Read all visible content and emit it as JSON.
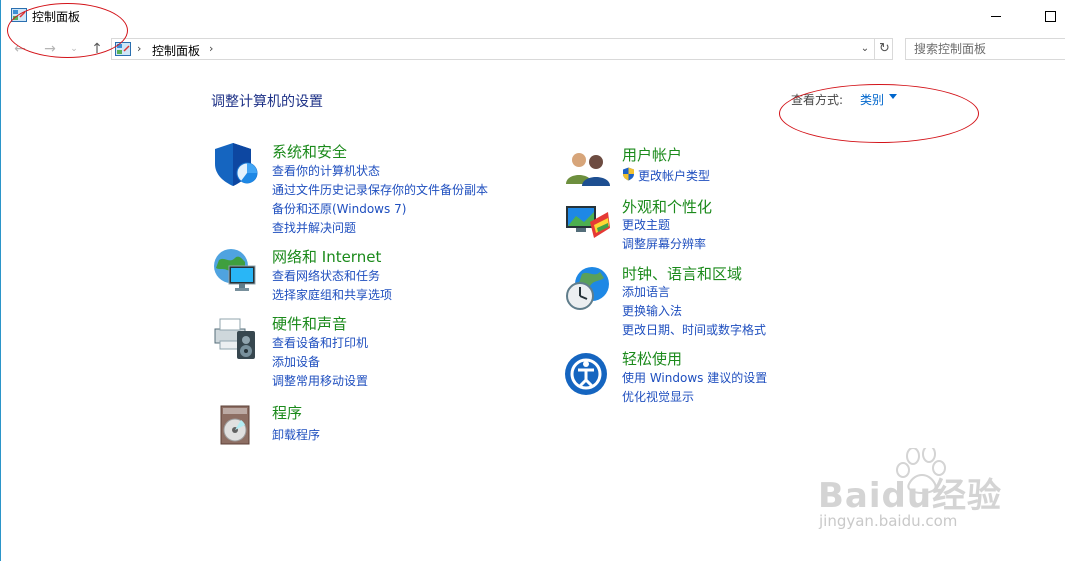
{
  "window": {
    "title": "控制面板"
  },
  "nav": {
    "back_glyph": "←",
    "forward_glyph": "→",
    "recent_glyph": "⌄",
    "up_glyph": "↑"
  },
  "address": {
    "separator": "›",
    "location": "控制面板",
    "dropdown_glyph": "⌄",
    "refresh_glyph": "↻"
  },
  "search": {
    "placeholder": "搜索控制面板"
  },
  "page": {
    "heading": "调整计算机的设置",
    "view_by_label": "查看方式:",
    "view_by_value": "类别"
  },
  "categories": {
    "system_security": {
      "title": "系统和安全",
      "links": [
        "查看你的计算机状态",
        "通过文件历史记录保存你的文件备份副本",
        "备份和还原(Windows 7)",
        "查找并解决问题"
      ]
    },
    "network": {
      "title": "网络和 Internet",
      "links": [
        "查看网络状态和任务",
        "选择家庭组和共享选项"
      ]
    },
    "hardware": {
      "title": "硬件和声音",
      "links": [
        "查看设备和打印机",
        "添加设备",
        "调整常用移动设置"
      ]
    },
    "programs": {
      "title": "程序",
      "links": [
        "卸载程序"
      ]
    },
    "user_accounts": {
      "title": "用户帐户",
      "links": [
        "更改帐户类型"
      ]
    },
    "appearance": {
      "title": "外观和个性化",
      "links": [
        "更改主题",
        "调整屏幕分辨率"
      ]
    },
    "clock_region": {
      "title": "时钟、语言和区域",
      "links": [
        "添加语言",
        "更换输入法",
        "更改日期、时间或数字格式"
      ]
    },
    "ease_of_access": {
      "title": "轻松使用",
      "links": [
        "使用 Windows 建议的设置",
        "优化视觉显示"
      ]
    }
  },
  "watermark": {
    "brand": "Baidu经验",
    "url": "jingyan.baidu.com"
  },
  "colors": {
    "title_green": "#1b8a1b",
    "link_blue": "#1f4fbf",
    "heading_blue": "#1e3287",
    "annotation_red": "#d3141a"
  }
}
